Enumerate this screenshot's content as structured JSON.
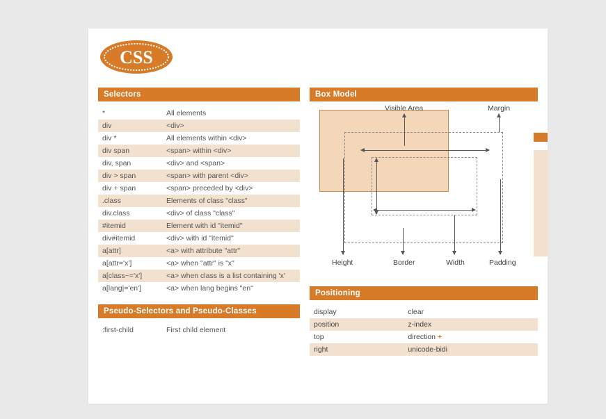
{
  "logo_text": "CSS",
  "sections": {
    "selectors_title": "Selectors",
    "pseudo_title": "Pseudo-Selectors and Pseudo-Classes",
    "boxmodel_title": "Box Model",
    "positioning_title": "Positioning"
  },
  "selectors": [
    {
      "sel": "*",
      "desc": "All elements"
    },
    {
      "sel": "div",
      "desc": "<div>"
    },
    {
      "sel": "div *",
      "desc": "All elements within <div>"
    },
    {
      "sel": "div span",
      "desc": "<span> within <div>"
    },
    {
      "sel": "div, span",
      "desc": "<div> and <span>"
    },
    {
      "sel": "div > span",
      "desc": "<span> with parent <div>"
    },
    {
      "sel": "div + span",
      "desc": "<span> preceded by <div>"
    },
    {
      "sel": ".class",
      "desc": "Elements of class \"class\""
    },
    {
      "sel": "div.class",
      "desc": "<div> of class \"class\""
    },
    {
      "sel": "#itemid",
      "desc": "Element with id \"itemid\""
    },
    {
      "sel": "div#itemid",
      "desc": "<div> with id \"itemid\""
    },
    {
      "sel": "a[attr]",
      "desc": "<a> with attribute \"attr\""
    },
    {
      "sel": "a[attr='x']",
      "desc": "<a> when \"attr\" is \"x\""
    },
    {
      "sel": "a[class~='x']",
      "desc": "<a> when class is a list containing 'x'"
    },
    {
      "sel": "a[lang|='en']",
      "desc": "<a> when lang begins \"en\""
    }
  ],
  "pseudo": [
    {
      "sel": ":first-child",
      "desc": "First child element"
    }
  ],
  "boxmodel_labels": {
    "visible": "Visible Area",
    "margin": "Margin",
    "height": "Height",
    "border": "Border",
    "width": "Width",
    "padding": "Padding"
  },
  "positioning": [
    {
      "l": "display",
      "r": "clear",
      "plus": false
    },
    {
      "l": "position",
      "r": "z-index",
      "plus": false
    },
    {
      "l": "top",
      "r": "direction",
      "plus": true
    },
    {
      "l": "right",
      "r": "unicode-bidi",
      "plus": false
    }
  ]
}
